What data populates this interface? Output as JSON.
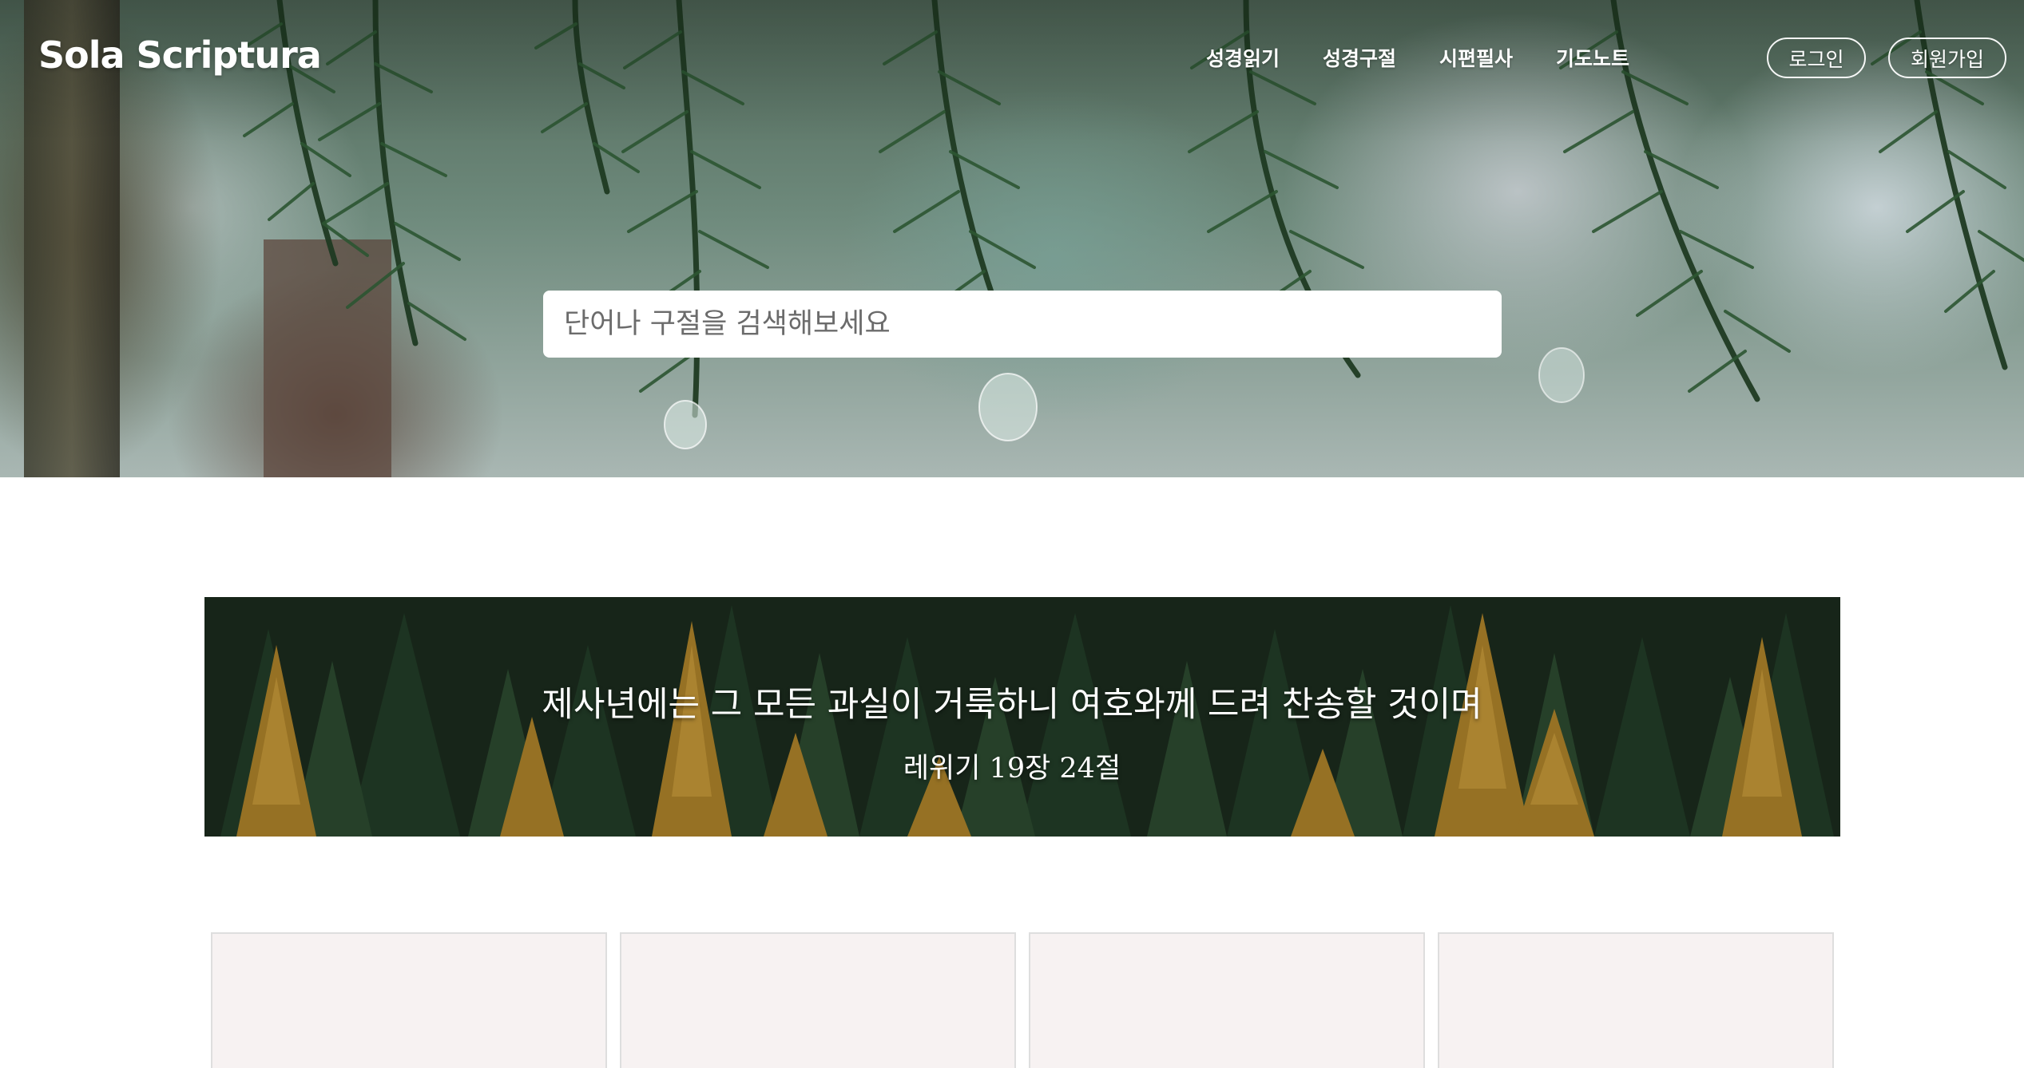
{
  "header": {
    "logo": "Sola Scriptura",
    "nav": [
      {
        "label": "성경읽기"
      },
      {
        "label": "성경구절"
      },
      {
        "label": "시편필사"
      },
      {
        "label": "기도노트"
      }
    ],
    "login_label": "로그인",
    "signup_label": "회원가입"
  },
  "search": {
    "placeholder": "단어나 구절을 검색해보세요"
  },
  "verse": {
    "text": "제사년에는 그 모든 과실이 거룩하니 여호와께 드려 찬송할 것이며",
    "reference": "레위기 19장 24절"
  },
  "colors": {
    "card_background": "#f7f2f2",
    "card_border": "#dedede",
    "header_text": "#ffffff"
  }
}
